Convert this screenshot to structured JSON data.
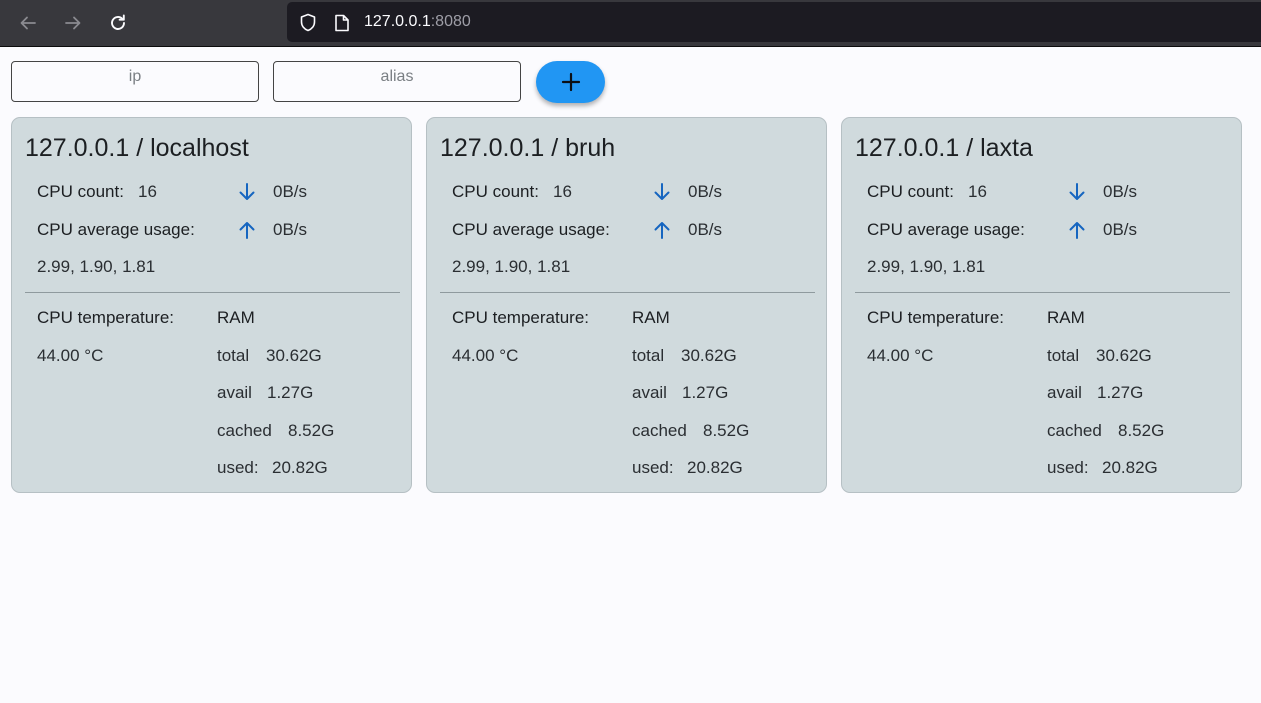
{
  "browser": {
    "url_host": "127.0.0.1",
    "url_port": ":8080"
  },
  "form": {
    "ip_placeholder": "ip",
    "alias_placeholder": "alias",
    "add_icon": "plus-icon"
  },
  "colors": {
    "accent": "#2196f3",
    "card_bg": "#d0dadd",
    "arrow": "#1565c0"
  },
  "servers": [
    {
      "title": "127.0.0.1 / localhost",
      "cpu_count_label": "CPU count:",
      "cpu_count": "16",
      "download_rate": "0B/s",
      "cpu_avg_label": "CPU average usage:",
      "upload_rate": "0B/s",
      "load_avg": "2.99, 1.90, 1.81",
      "cpu_temp_label": "CPU temperature:",
      "cpu_temp": "44.00 °C",
      "ram_label": "RAM",
      "ram_total_label": "total",
      "ram_total": "30.62G",
      "ram_avail_label": "avail",
      "ram_avail": "1.27G",
      "ram_cached_label": "cached",
      "ram_cached": "8.52G",
      "ram_used_label": "used:",
      "ram_used": "20.82G"
    },
    {
      "title": "127.0.0.1 / bruh",
      "cpu_count_label": "CPU count:",
      "cpu_count": "16",
      "download_rate": "0B/s",
      "cpu_avg_label": "CPU average usage:",
      "upload_rate": "0B/s",
      "load_avg": "2.99, 1.90, 1.81",
      "cpu_temp_label": "CPU temperature:",
      "cpu_temp": "44.00 °C",
      "ram_label": "RAM",
      "ram_total_label": "total",
      "ram_total": "30.62G",
      "ram_avail_label": "avail",
      "ram_avail": "1.27G",
      "ram_cached_label": "cached",
      "ram_cached": "8.52G",
      "ram_used_label": "used:",
      "ram_used": "20.82G"
    },
    {
      "title": "127.0.0.1 / laxta",
      "cpu_count_label": "CPU count:",
      "cpu_count": "16",
      "download_rate": "0B/s",
      "cpu_avg_label": "CPU average usage:",
      "upload_rate": "0B/s",
      "load_avg": "2.99, 1.90, 1.81",
      "cpu_temp_label": "CPU temperature:",
      "cpu_temp": "44.00 °C",
      "ram_label": "RAM",
      "ram_total_label": "total",
      "ram_total": "30.62G",
      "ram_avail_label": "avail",
      "ram_avail": "1.27G",
      "ram_cached_label": "cached",
      "ram_cached": "8.52G",
      "ram_used_label": "used:",
      "ram_used": "20.82G"
    }
  ]
}
